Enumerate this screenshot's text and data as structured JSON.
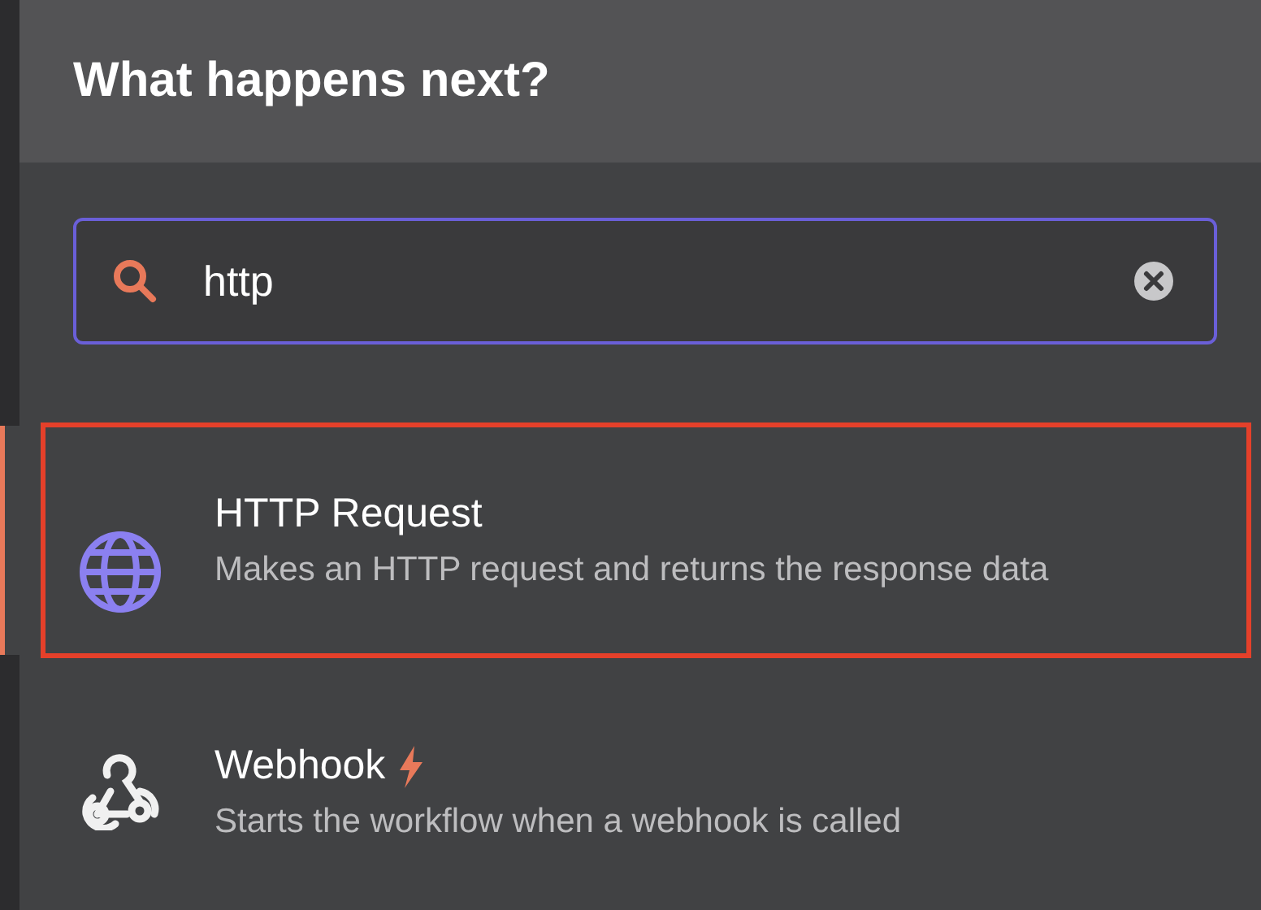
{
  "header": {
    "title": "What happens next?"
  },
  "search": {
    "value": "http",
    "focused": true
  },
  "results": [
    {
      "kind": "globe",
      "title": "HTTP Request",
      "description": "Makes an HTTP request and returns the response data",
      "selected": true,
      "highlighted": true,
      "trigger": false
    },
    {
      "kind": "webhook",
      "title": "Webhook",
      "description": "Starts the workflow when a webhook is called",
      "selected": false,
      "highlighted": false,
      "trigger": true
    }
  ]
}
